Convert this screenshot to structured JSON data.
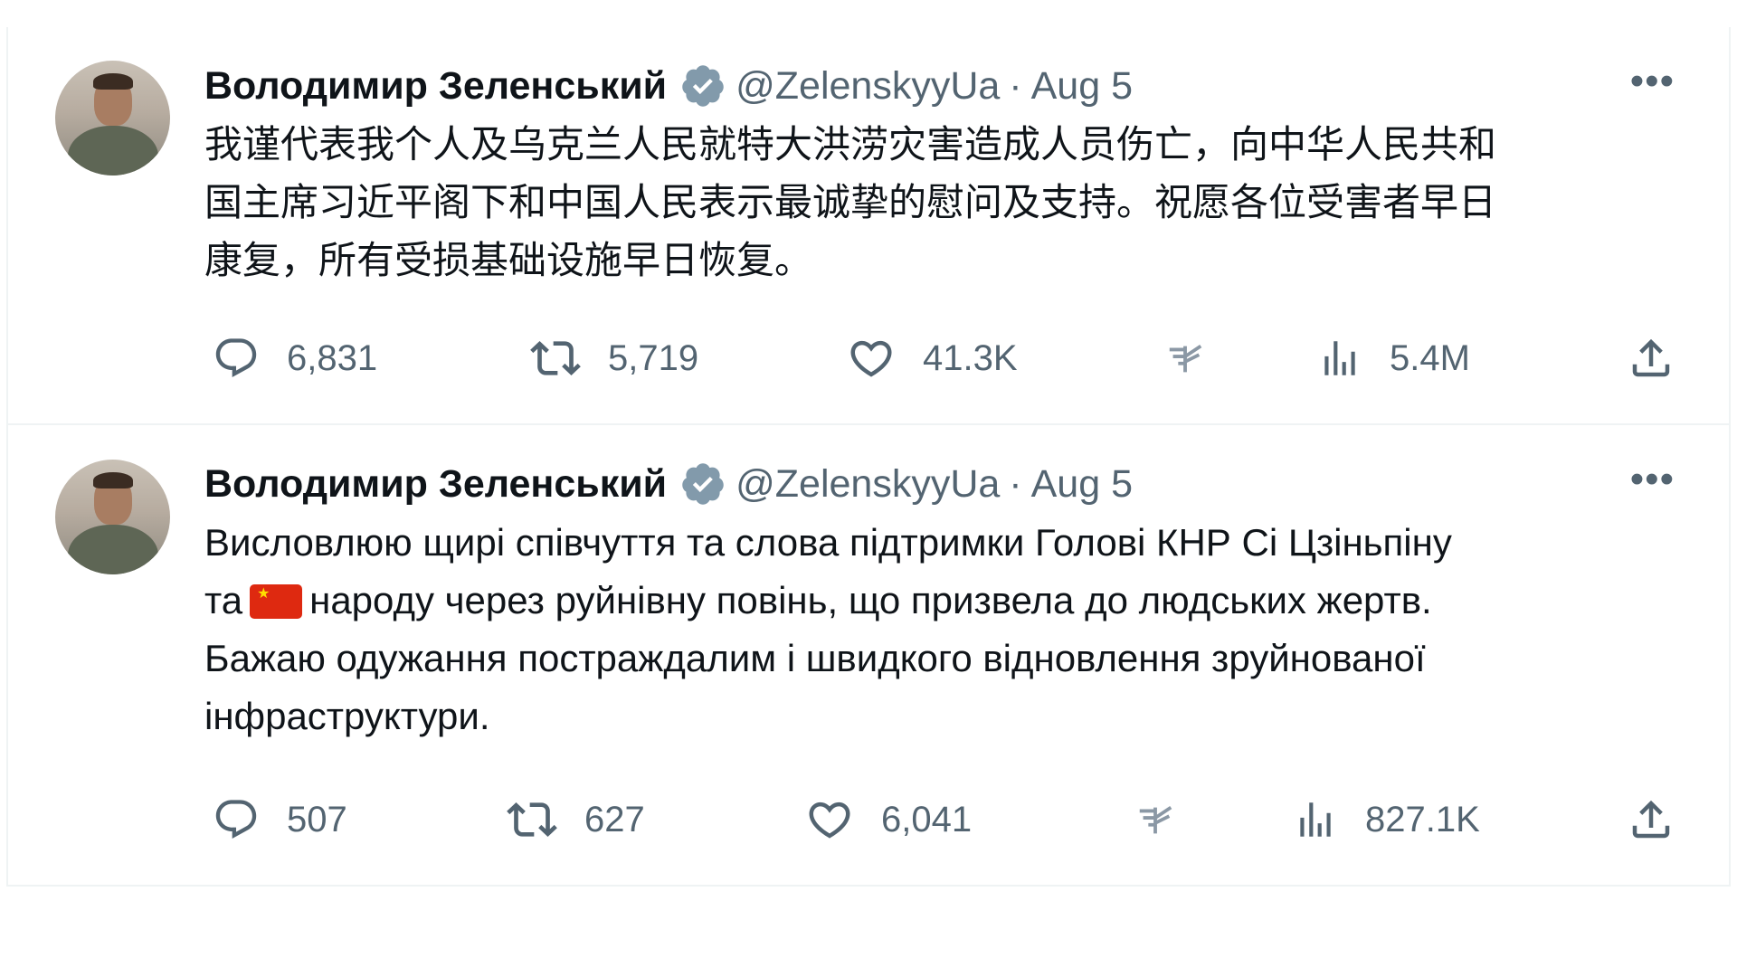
{
  "tweets": [
    {
      "author": "Володимир Зеленський",
      "handle": "@ZelenskyyUa",
      "separator": "·",
      "date": "Aug 5",
      "more": "•••",
      "text": "我谨代表我个人及乌克兰人民就特大洪涝灾害造成人员伤亡，向中华人民共和\n国主席习近平阁下和中国人民表示最诚挚的慰问及支持。祝愿各位受害者早日\n康复，所有受损基础设施早日恢复。",
      "replies": "6,831",
      "reposts": "5,719",
      "likes": "41.3K",
      "views": "5.4M"
    },
    {
      "author": "Володимир Зеленський",
      "handle": "@ZelenskyyUa",
      "separator": "·",
      "date": "Aug 5",
      "more": "•••",
      "text_before_flag": "Висловлюю щирі співчуття та слова підтримки Голові КНР Сі Цзіньпіну\nта",
      "text_after_flag": "народу через руйнівну повінь, що призвела до людських жертв.\nБажаю одужання постраждалим і швидкого відновлення зруйнованої\nінфраструктури.",
      "replies": "507",
      "reposts": "627",
      "likes": "6,041",
      "views": "827.1K"
    }
  ],
  "icons": {
    "reply": "reply-icon",
    "repost": "repost-icon",
    "like": "heart-icon",
    "grok": "grok-icon",
    "views": "views-icon",
    "share": "share-icon",
    "verified": "verified-badge-icon"
  },
  "colors": {
    "text_primary": "#0f1419",
    "text_secondary": "#536471",
    "verified_badge": "#829aab",
    "flag_red": "#de2910",
    "flag_star": "#ffde00"
  }
}
